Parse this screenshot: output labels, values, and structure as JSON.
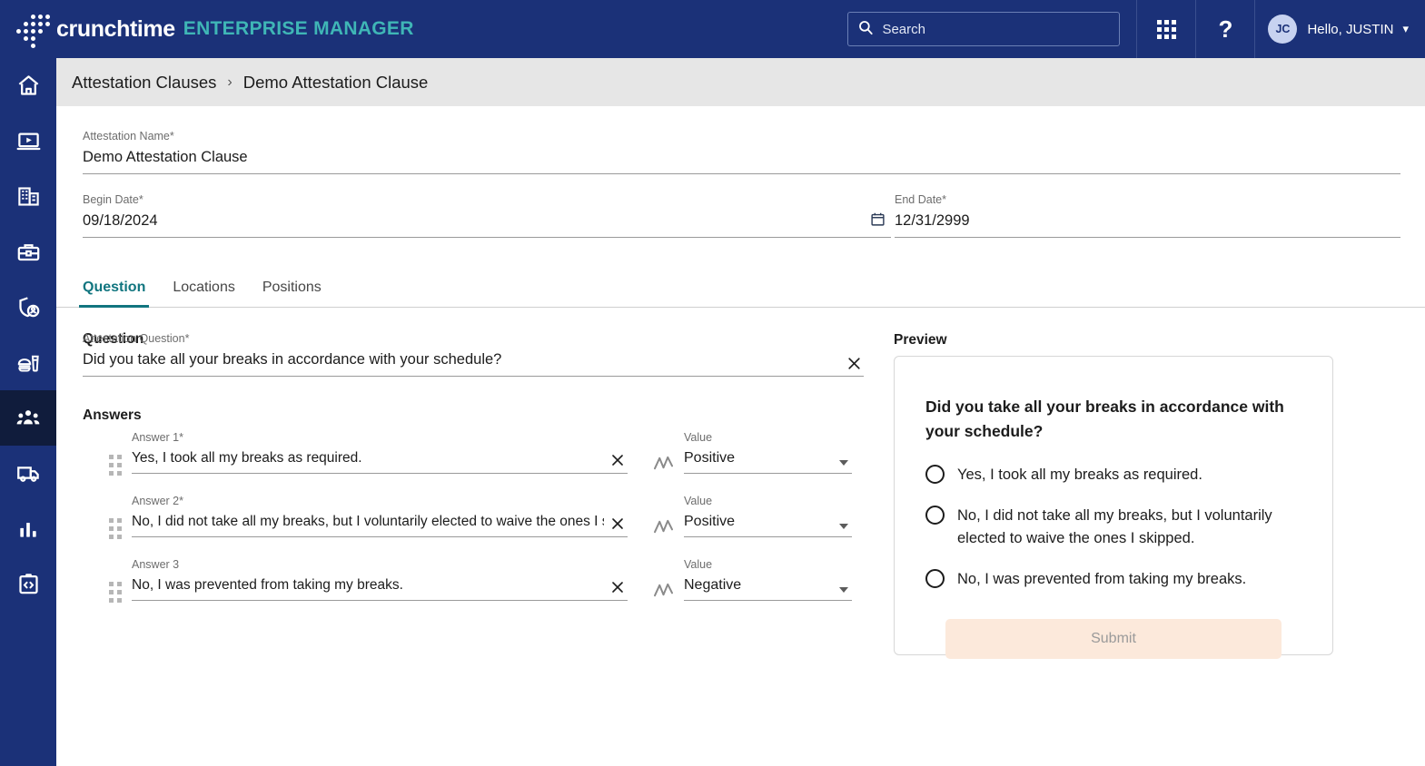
{
  "header": {
    "brand_name": "crunchtime",
    "brand_suffix": "ENTERPRISE MANAGER",
    "search_placeholder": "Search",
    "apps_icon": "grid-apps-icon",
    "help_label": "?",
    "avatar_initials": "JC",
    "user_greeting": "Hello, JUSTIN",
    "chevron": "▾",
    "navy": "#1b3178",
    "teal": "#3fb6b6"
  },
  "sidebar": {
    "active_index": 6,
    "active_bg": "#101c3c",
    "items": [
      {
        "icon": "home-icon",
        "name": "home"
      },
      {
        "icon": "video-training-icon",
        "name": "training"
      },
      {
        "icon": "building-icon",
        "name": "locations"
      },
      {
        "icon": "toolbox-icon",
        "name": "tools"
      },
      {
        "icon": "shield-person-icon",
        "name": "compliance"
      },
      {
        "icon": "food-burger-drink-icon",
        "name": "inventory"
      },
      {
        "icon": "people-group-icon",
        "name": "labor"
      },
      {
        "icon": "delivery-truck-icon",
        "name": "supply-chain"
      },
      {
        "icon": "bar-chart-icon",
        "name": "reporting"
      },
      {
        "icon": "clipboard-code-icon",
        "name": "admin"
      }
    ]
  },
  "breadcrumb": {
    "root": "Attestation Clauses",
    "separator": "›",
    "current": "Demo Attestation Clause"
  },
  "form": {
    "attestation_name_label": "Attestation Name*",
    "attestation_name_value": "Demo Attestation Clause",
    "begin_date_label": "Begin Date*",
    "begin_date_value": "09/18/2024",
    "begin_date_icon": "calendar-icon",
    "end_date_label": "End Date*",
    "end_date_value": "12/31/2999"
  },
  "tabs": [
    {
      "label": "Question",
      "active": true
    },
    {
      "label": "Locations",
      "active": false
    },
    {
      "label": "Positions",
      "active": false
    }
  ],
  "question_section": {
    "heading": "Question",
    "question_label": "Attestation Question*",
    "question_value": "Did you take all your breaks in accordance with your schedule?",
    "clear_icon": "close-x-icon",
    "answers_heading": "Answers",
    "value_icon": "trend-line-icon",
    "answers": [
      {
        "label": "Answer 1*",
        "text": "Yes, I took all my breaks as required.",
        "value_label": "Value",
        "value": "Positive"
      },
      {
        "label": "Answer 2*",
        "text": "No, I did not take all my breaks, but I voluntarily elected to waive the ones I skipped.",
        "value_label": "Value",
        "value": "Positive"
      },
      {
        "label": "Answer 3",
        "text": "No, I was prevented from taking my breaks.",
        "value_label": "Value",
        "value": "Negative"
      }
    ]
  },
  "preview": {
    "heading": "Preview",
    "question": "Did you take all your breaks in accordance with your schedule?",
    "options": [
      "Yes, I took all my breaks as required.",
      "No, I did not take all my breaks, but I voluntarily elected to waive the ones I skipped.",
      "No, I was prevented from taking my breaks."
    ],
    "submit_label": "Submit",
    "submit_bg": "#fce9db",
    "submit_text_color": "#9a9a9a"
  }
}
